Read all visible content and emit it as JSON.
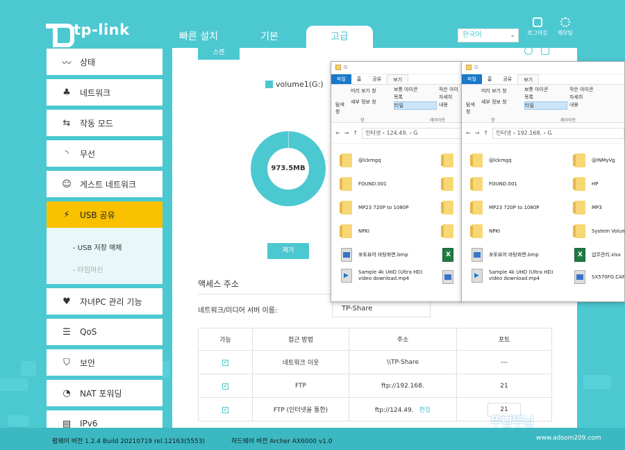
{
  "header": {
    "logo": "tp-link",
    "tabs": [
      {
        "label": "빠른 설치"
      },
      {
        "label": "기본"
      },
      {
        "label": "고급"
      }
    ],
    "language": "한국어",
    "logout_label": "로그아웃",
    "reboot_label": "재부팅"
  },
  "sidebar": {
    "items": [
      {
        "label": "상태",
        "icon": "pulse-icon"
      },
      {
        "label": "네트워크",
        "icon": "network-icon"
      },
      {
        "label": "작동 모드",
        "icon": "mode-icon"
      },
      {
        "label": "무선",
        "icon": "wifi-icon"
      },
      {
        "label": "게스트 네트워크",
        "icon": "guest-icon"
      },
      {
        "label": "USB 공유",
        "icon": "usb-icon"
      },
      {
        "label": "자녀PC 관리 기능",
        "icon": "parental-icon"
      },
      {
        "label": "QoS",
        "icon": "qos-icon"
      },
      {
        "label": "보안",
        "icon": "shield-icon"
      },
      {
        "label": "NAT 포워딩",
        "icon": "nat-icon"
      },
      {
        "label": "IPv6",
        "icon": "ipv6-icon"
      }
    ],
    "subitems": [
      {
        "label": "- USB 저장 매체"
      },
      {
        "label": "- 타임머신"
      }
    ]
  },
  "main": {
    "scan_button": "스캔",
    "volume_label": "volume1(G:)",
    "donut_center": "973.5MB",
    "remove_button": "제거",
    "access_title": "액세스 주소",
    "server_label": "네트워크/미디어 서버 이름:",
    "server_value": "TP-Share",
    "table": {
      "headers": [
        "가능",
        "접근 방법",
        "주소",
        "포트"
      ],
      "rows": [
        {
          "method": "네트워크 이웃",
          "address": "\\\\TP-Share",
          "port": "---"
        },
        {
          "method": "FTP",
          "address": "ftp://192.168.",
          "port": "21"
        },
        {
          "method": "FTP (인터넷을 통한)",
          "address": "ftp://124.49.",
          "port": "21",
          "edit": "편집"
        }
      ]
    }
  },
  "footer": {
    "firmware": "펌웨어 버전 1.2.4 Build 20210719 rel.12163(5553)",
    "hardware": "하드웨어 버전 Archer AX6000 v1.0"
  },
  "explorer1": {
    "title": "G",
    "tabs": [
      "파일",
      "홈",
      "공유",
      "보기"
    ],
    "ribbon": {
      "nav": "탐색 창",
      "preview": "미리 보기 창",
      "details": "세부 정보 창",
      "normal_icons": "보통 아이콘",
      "list": "목록",
      "tiles": "타일",
      "small_icons": "작은 아이",
      "details_view": "자세히",
      "content": "내용",
      "pane_group": "창",
      "layout_group": "레이아웃"
    },
    "address": "인터넷 › 124.49.",
    "address_tail": "› G",
    "files": [
      {
        "name": "@lckmgq",
        "type": "folder"
      },
      {
        "name": "FOUND.001",
        "type": "folder"
      },
      {
        "name": "MP23 720P to 1080P",
        "type": "folder"
      },
      {
        "name": "NPKI",
        "type": "folder"
      },
      {
        "name": "포토뷰어 바탕화면.bmp",
        "type": "image"
      },
      {
        "name": "Sample 4k UHD (Ultra HD) video download.mp4",
        "type": "video"
      }
    ]
  },
  "explorer2": {
    "title": "G",
    "tabs": [
      "파일",
      "홈",
      "공유",
      "보기"
    ],
    "ribbon": {
      "nav": "탐색 창",
      "preview": "미리 보기 창",
      "details": "세부 정보 창",
      "normal_icons": "보통 아이콘",
      "list": "목록",
      "tiles": "타일",
      "small_icons": "작은 아이콘",
      "details_view": "자세히",
      "content": "내용",
      "pane_group": "창",
      "layout_group": "레이아웃"
    },
    "address": "인터넷 › 192.168.",
    "address_tail": "› G",
    "files": [
      {
        "name": "@lckmgq",
        "type": "folder"
      },
      {
        "name": "FOUND.001",
        "type": "folder"
      },
      {
        "name": "MP23 720P to 1080P",
        "type": "folder"
      },
      {
        "name": "NPKI",
        "type": "folder"
      },
      {
        "name": "포토뷰어 바탕화면.bmp",
        "type": "image"
      },
      {
        "name": "Sample 4k UHD (Ultra HD) video download.mp4",
        "type": "video"
      },
      {
        "name": "@INMyVg",
        "type": "folder"
      },
      {
        "name": "HP",
        "type": "folder"
      },
      {
        "name": "MP3",
        "type": "folder"
      },
      {
        "name": "System Volume",
        "type": "folder"
      },
      {
        "name": "업무관리.xlsx",
        "type": "excel"
      },
      {
        "name": "SX570FG.CAP",
        "type": "image"
      }
    ]
  },
  "watermark": "뚜닝뚜닝",
  "watermark_url": "www.adsom209.com"
}
